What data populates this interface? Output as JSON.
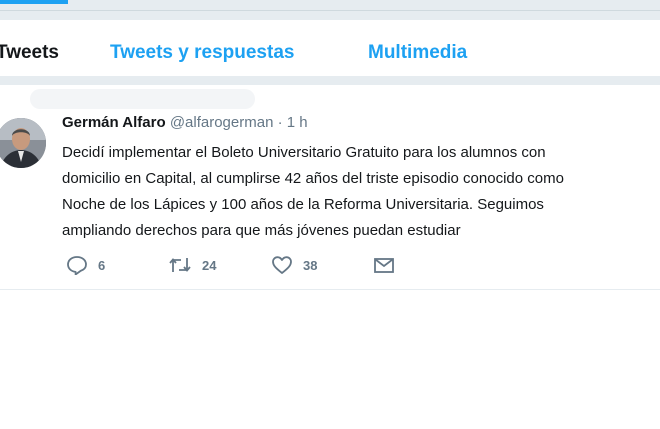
{
  "tabs": [
    {
      "label": "Tweets",
      "active": true
    },
    {
      "label": "Tweets y respuestas",
      "active": false
    },
    {
      "label": "Multimedia",
      "active": false
    }
  ],
  "tweet": {
    "name": "Germán Alfaro",
    "handle": "@alfarogerman",
    "separator": "·",
    "time": "1 h",
    "lines": [
      "Decidí implementar el Boleto Universitario Gratuito para los alumnos con",
      "domicilio en Capital, al cumplirse 42 años del triste episodio conocido como",
      "Noche de los Lápices y 100 años de la Reforma Universitaria. Seguimos",
      "ampliando derechos para que más jóvenes puedan estudiar"
    ],
    "actions": {
      "reply": {
        "icon": "reply-icon",
        "count": "6"
      },
      "retweet": {
        "icon": "retweet-icon",
        "count": "24"
      },
      "like": {
        "icon": "heart-icon",
        "count": "38"
      },
      "dm": {
        "icon": "envelope-icon"
      }
    }
  },
  "colors": {
    "accent": "#1da1f2",
    "text": "#14171a",
    "muted": "#657786",
    "background_gray": "#e6ecf0"
  }
}
